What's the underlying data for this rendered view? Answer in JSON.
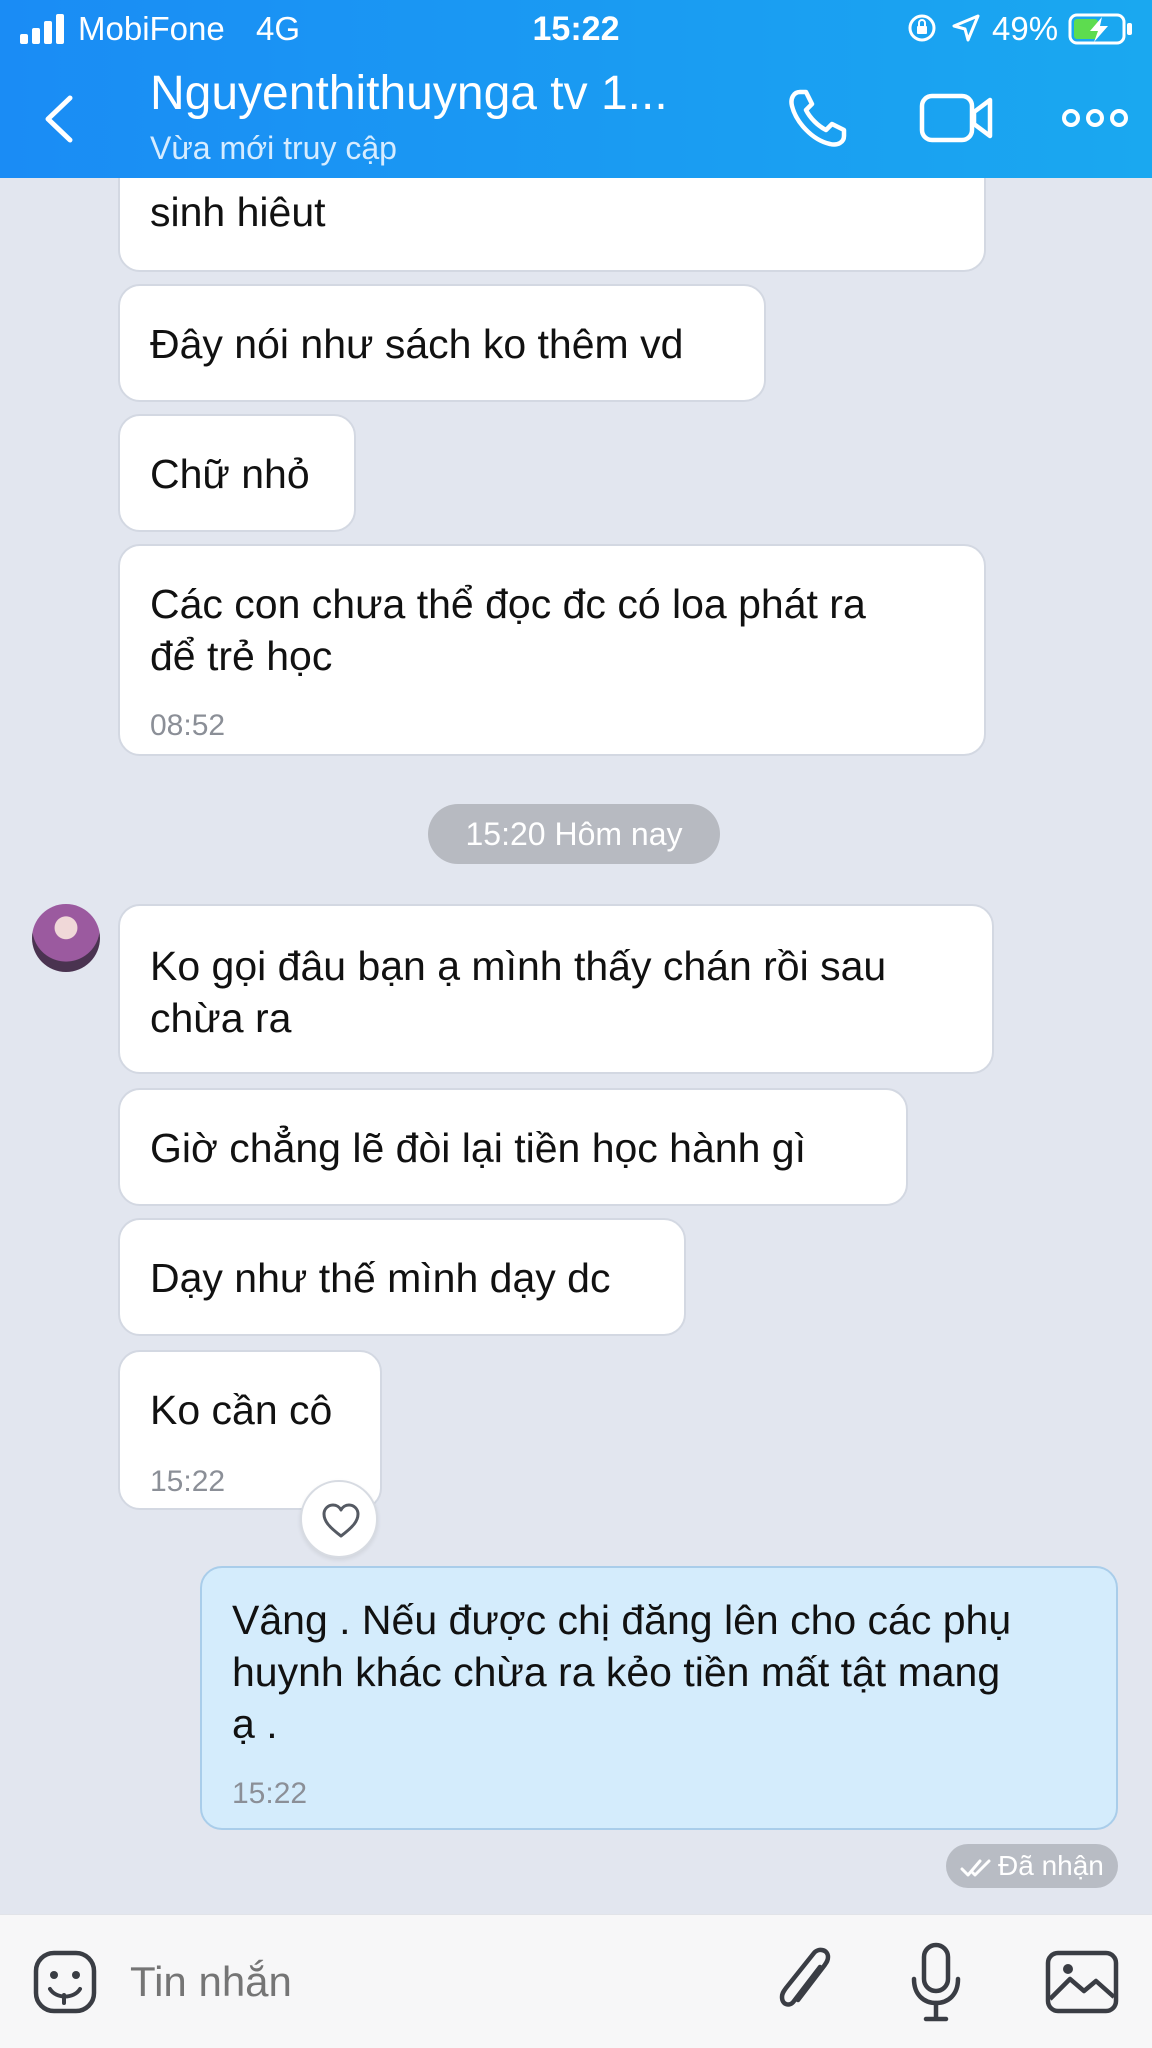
{
  "status_bar": {
    "carrier": "MobiFone",
    "network": "4G",
    "time": "15:22",
    "battery": "49%"
  },
  "header": {
    "title": "Nguyenthithuynga tv 1...",
    "subtitle": "Vừa mới truy cập"
  },
  "messages": [
    {
      "text_lines": [
        "sinh hiêut"
      ],
      "time": ""
    },
    {
      "text_lines": [
        "Đây nói như sách ko thêm vd"
      ],
      "time": ""
    },
    {
      "text_lines": [
        "Chữ nhỏ"
      ],
      "time": ""
    },
    {
      "text_lines": [
        "Các con chưa thể đọc đc có loa phát ra",
        "để trẻ học"
      ],
      "time": "08:52"
    },
    {
      "text_lines": [
        "Ko gọi đâu bạn ạ mình thấy chán rồi sau",
        "chừa ra"
      ],
      "time": ""
    },
    {
      "text_lines": [
        "Giờ chẳng lẽ đòi lại tiền học hành gì"
      ],
      "time": ""
    },
    {
      "text_lines": [
        "Dạy như thế mình dạy dc"
      ],
      "time": ""
    },
    {
      "text_lines": [
        "Ko cần cô"
      ],
      "time": "15:22"
    },
    {
      "text_lines": [
        "Vâng . Nếu được chị đăng lên cho các phụ",
        "huynh khác chừa ra kẻo tiền mất tật mang",
        "ạ ."
      ],
      "time": "15:22"
    }
  ],
  "date_separator": "15:20 Hôm nay",
  "received_status": "Đã nhận",
  "composer": {
    "placeholder": "Tin nhắn"
  },
  "colors": {
    "header": "#1a8cf5",
    "chat_background": "#e2e6ef",
    "sent_bubble": "#d4ecfc",
    "received_bubble": "#ffffff"
  }
}
